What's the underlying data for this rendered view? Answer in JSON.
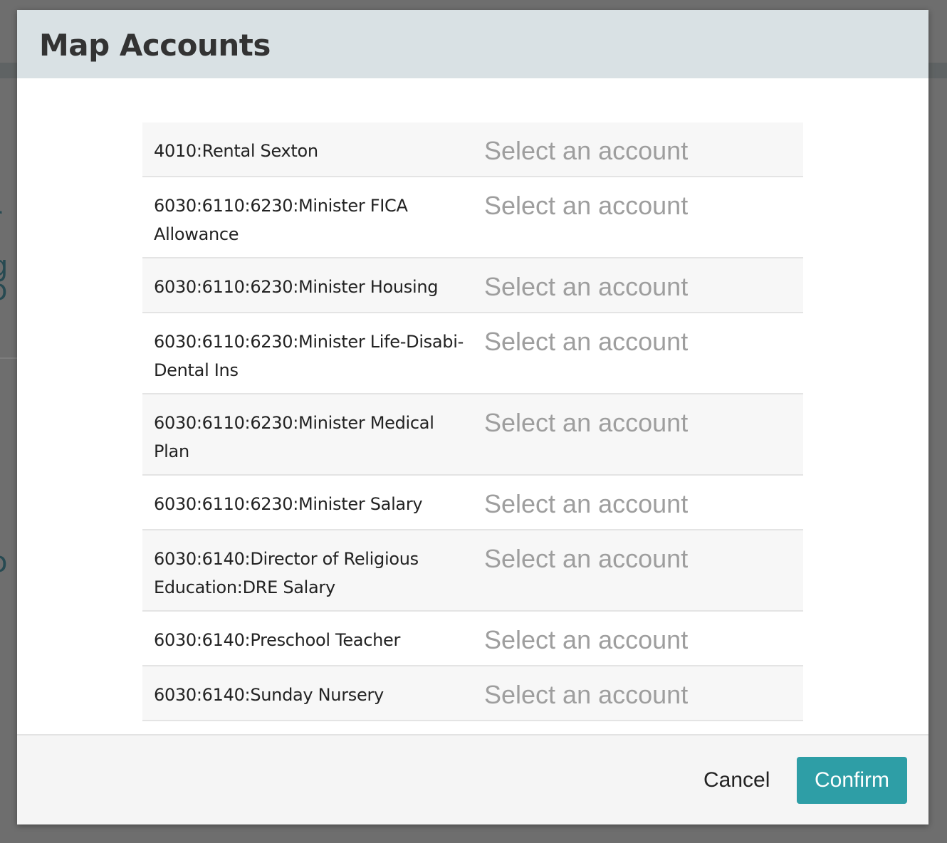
{
  "modal": {
    "title": "Map Accounts",
    "select_placeholder": "Select an account",
    "rows": [
      {
        "source": "4010:Rental Sexton"
      },
      {
        "source": "6030:6110:6230:Minister FICA Allowance"
      },
      {
        "source": "6030:6110:6230:Minister Housing"
      },
      {
        "source": "6030:6110:6230:Minister Life-Disabi-Dental Ins"
      },
      {
        "source": "6030:6110:6230:Minister Medical Plan"
      },
      {
        "source": "6030:6110:6230:Minister Salary"
      },
      {
        "source": "6030:6140:Director of Religious Education:DRE Salary"
      },
      {
        "source": "6030:6140:Preschool Teacher"
      },
      {
        "source": "6030:6140:Sunday Nursery"
      }
    ],
    "footer": {
      "cancel_label": "Cancel",
      "confirm_label": "Confirm"
    }
  },
  "colors": {
    "header_bg": "#d9e1e4",
    "accent": "#2e9ea6",
    "placeholder_text": "#9e9e9e",
    "overlay": "#6e6e6e"
  }
}
